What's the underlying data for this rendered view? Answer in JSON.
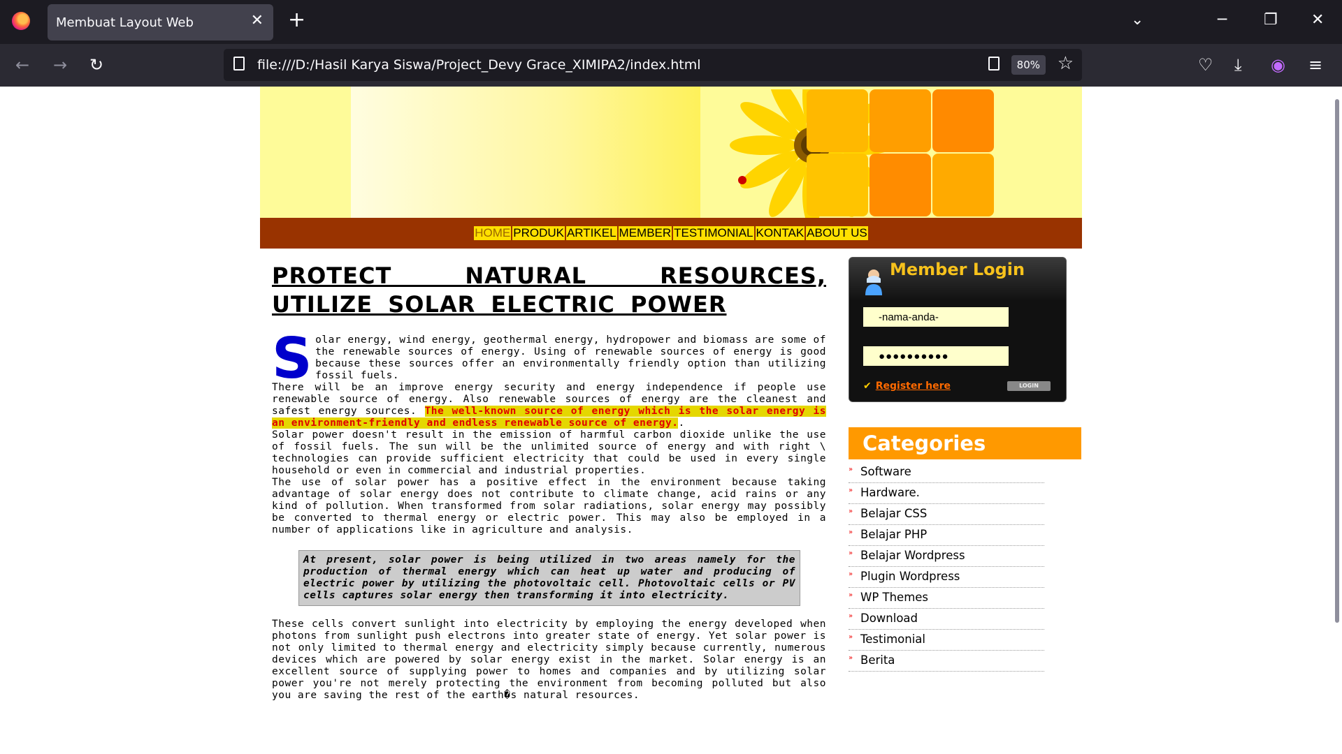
{
  "browser": {
    "tab_title": "Membuat Layout Web",
    "url": "file:///D:/Hasil Karya Siswa/Project_Devy Grace_XIMIPA2/index.html",
    "zoom": "80%"
  },
  "site": {
    "menu": [
      "HOME",
      "PRODUK",
      "ARTIKEL",
      "MEMBER",
      "TESTIMONIAL",
      "KONTAK",
      "ABOUT US"
    ],
    "article": {
      "title_line1": "PROTECT NATURAL RESOURCES,",
      "title_line2": "UTILIZE SOLAR ELECTRIC POWER",
      "drop_cap": "S",
      "p1": "olar energy, wind energy, geothermal energy, hydropower and biomass are some of the renewable sources of energy. Using of renewable sources of energy is good because these sources offer an environmentally friendly option than utilizing fossil fuels.",
      "p2_start": "There will be an improve energy security and energy independence if people use renewable source of energy. Also renewable sources of energy are the cleanest and safest energy sources.",
      "p2_highlight": "The well-known source of energy which is the solar energy is an environment-friendly and endless renewable source of energy.",
      "p2_end": ".",
      "p3": "Solar power doesn't result in the emission of harmful carbon dioxide unlike the use of fossil fuels. The sun will be the unlimited source of energy and with right \\ technologies can provide sufficient electricity that could be used in every single household or even in commercial and industrial properties.",
      "p4": "The use of solar power has a positive effect in the environment because taking advantage of solar energy does not contribute to climate change, acid rains or any kind of pollution. When transformed from solar radiations, solar energy may possibly be converted to thermal energy or electric power. This may also be employed in a number of applications like in agriculture and analysis.",
      "quote": "At present, solar power is being utilized in two areas namely for the production of thermal energy which can heat up water and producing of electric power by utilizing the photovoltaic cell. Photovoltaic cells or PV cells captures solar energy then transforming it into electricity.",
      "p5": "These cells convert sunlight into electricity by employing the energy developed when photons from sunlight push electrons into greater state of energy. Yet solar power is not only limited to thermal energy and electricity simply because currently, numerous devices which are powered by solar energy exist in the market. Solar energy is an excellent source of supplying power to homes and companies and by utilizing solar power you're not merely protecting the environment from becoming polluted but also you are saving the rest of the earth�s natural resources."
    },
    "login": {
      "title": "Member Login",
      "username_value": "-nama-anda-",
      "password_value": "●●●●●●●●●●",
      "register_label": "Register here",
      "login_button": "LOGIN"
    },
    "categories": {
      "heading": "Categories",
      "items": [
        "Software",
        "Hardware.",
        "Belajar CSS",
        "Belajar PHP",
        "Belajar Wordpress",
        "Plugin Wordpress",
        "WP Themes",
        "Download",
        "Testimonial",
        "Berita"
      ]
    }
  }
}
